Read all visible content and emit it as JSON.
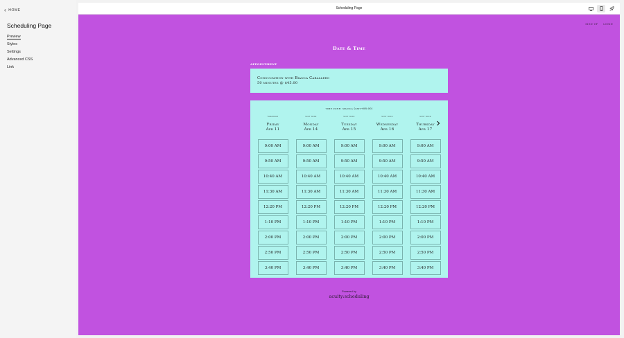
{
  "sidebar": {
    "home_label": "HOME",
    "title": "Scheduling Page",
    "nav": [
      "Preview",
      "Styles",
      "Settings",
      "Advanced CSS",
      "Link"
    ]
  },
  "topbar": {
    "page_name": "Scheduling Page",
    "icons": [
      "desktop-icon",
      "mobile-icon",
      "rocket-icon"
    ]
  },
  "site": {
    "nav": {
      "signup": "SIGN UP",
      "login": "LOGIN"
    },
    "heading": "Date & Time",
    "appointment_label": "APPOINTMENT",
    "appointment": {
      "name": "Consultation with Bianca Caballero",
      "detail": "50 minutes @ $45.00"
    },
    "timezone": "time zone: manila (gmt+08:00)",
    "days": [
      {
        "relative": "tomorrow",
        "name": "Friday",
        "date": "Apr 11"
      },
      {
        "relative": "next week",
        "name": "Monday",
        "date": "Apr 14"
      },
      {
        "relative": "next week",
        "name": "Tuesday",
        "date": "Apr 15"
      },
      {
        "relative": "next week",
        "name": "Wednesday",
        "date": "Apr 16"
      },
      {
        "relative": "next week",
        "name": "Thursday",
        "date": "Apr 17"
      }
    ],
    "times": [
      "9:00 AM",
      "9:50 AM",
      "10:40 AM",
      "11:30 AM",
      "12:20 PM",
      "1:10 PM",
      "2:00 PM",
      "2:50 PM",
      "3:40 PM"
    ],
    "powered_by": "Powered by",
    "logo_text": "acuity:scheduling"
  },
  "colors": {
    "canvas": "#c152e0",
    "card": "#b0f4ee"
  }
}
